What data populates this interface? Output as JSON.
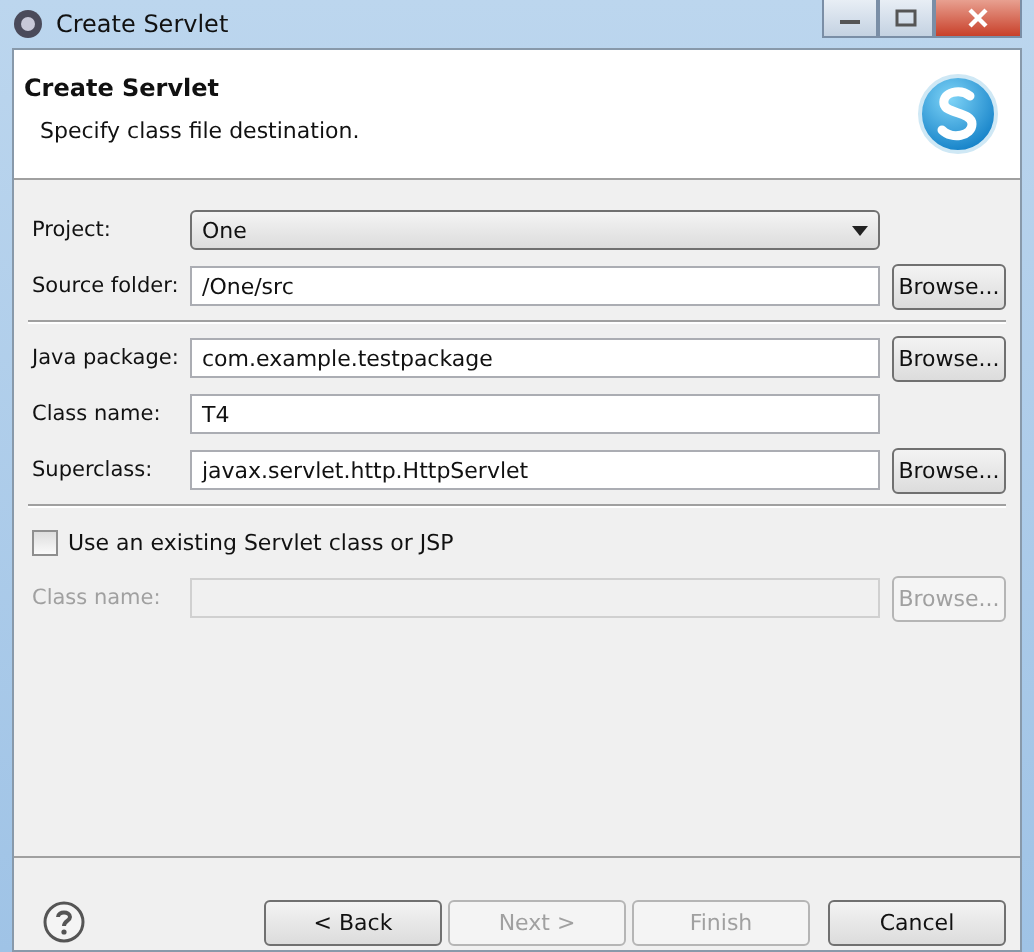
{
  "window": {
    "title": "Create Servlet"
  },
  "header": {
    "title": "Create Servlet",
    "description": "Specify class file destination."
  },
  "rows": [
    {
      "kind": "combo",
      "label": "Project:",
      "value": "One"
    },
    {
      "kind": "text",
      "label": "Source folder:",
      "value": "/One/src",
      "button": "Browse...",
      "disabled": false
    },
    {
      "kind": "separator"
    },
    {
      "kind": "text",
      "label": "Java package:",
      "value": "com.example.testpackage",
      "button": "Browse...",
      "disabled": false
    },
    {
      "kind": "text",
      "label": "Class name:",
      "value": "T4",
      "disabled": false
    },
    {
      "kind": "text",
      "label": "Superclass:",
      "value": "javax.servlet.http.HttpServlet",
      "button": "Browse...",
      "disabled": false
    },
    {
      "kind": "separator"
    },
    {
      "kind": "checkbox",
      "label": "Use an existing Servlet class or JSP",
      "checked": false
    },
    {
      "kind": "text",
      "label": "Class name:",
      "value": "",
      "button": "Browse...",
      "disabled": true
    }
  ],
  "buttons": [
    {
      "label": "< Back",
      "disabled": false
    },
    {
      "label": "Next >",
      "disabled": true
    },
    {
      "label": "Finish",
      "disabled": true
    },
    {
      "label": "Cancel",
      "disabled": false
    }
  ]
}
